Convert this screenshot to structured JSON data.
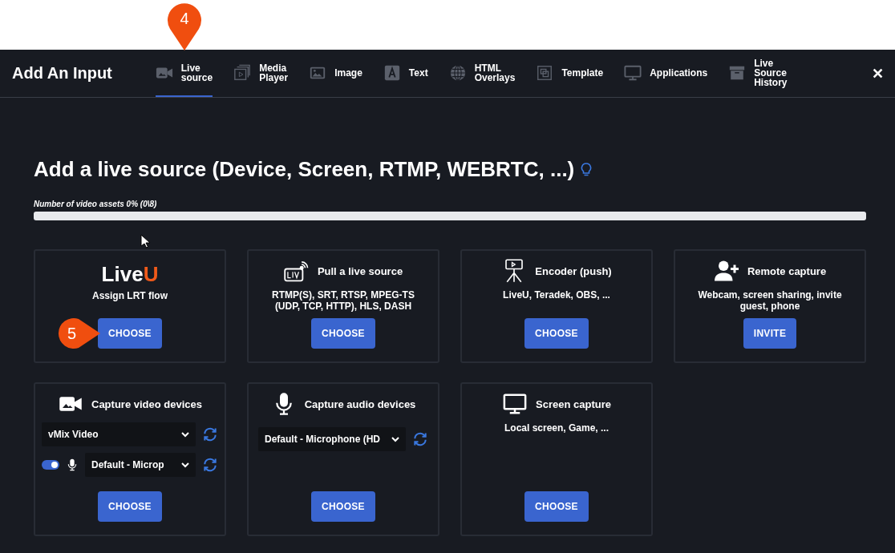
{
  "header": {
    "title": "Add An Input",
    "close": "✕"
  },
  "tabs": [
    {
      "lines": [
        "Live",
        "source"
      ],
      "selected": true
    },
    {
      "lines": [
        "Media",
        "Player"
      ],
      "selected": false
    },
    {
      "lines": [
        "Image"
      ],
      "selected": false
    },
    {
      "lines": [
        "Text"
      ],
      "selected": false
    },
    {
      "lines": [
        "HTML",
        "Overlays"
      ],
      "selected": false
    },
    {
      "lines": [
        "Template"
      ],
      "selected": false
    },
    {
      "lines": [
        "Applications"
      ],
      "selected": false
    },
    {
      "lines": [
        "Live",
        "Source",
        "History"
      ],
      "selected": false
    }
  ],
  "heading": "Add a live source (Device, Screen, RTMP, WEBRTC, ...)",
  "assets": {
    "label": "Number of video assets 0% (0\\8)",
    "level": 0
  },
  "cards": [
    {
      "kind": "logo",
      "logo": {
        "text": "Live",
        "accent": "U"
      },
      "description": "Assign LRT flow",
      "button": "CHOOSE"
    },
    {
      "kind": "basic",
      "title": "Pull a live source",
      "description": "RTMP(S), SRT, RTSP, MPEG-TS (UDP, TCP, HTTP), HLS, DASH",
      "button": "CHOOSE"
    },
    {
      "kind": "basic",
      "title": "Encoder (push)",
      "description": "LiveU, Teradek, OBS, ...",
      "button": "CHOOSE"
    },
    {
      "kind": "basic",
      "title": "Remote capture",
      "description": "Webcam, screen sharing, invite guest, phone",
      "button": "INVITE"
    },
    {
      "kind": "video",
      "title": "Capture video devices",
      "video_device": "vMix Video",
      "audio_on": true,
      "audio_device": "Default - Microp",
      "button": "CHOOSE"
    },
    {
      "kind": "audio",
      "title": "Capture audio devices",
      "audio_device": "Default - Microphone (HD",
      "button": "CHOOSE"
    },
    {
      "kind": "basic",
      "title": "Screen capture",
      "description": "Local screen, Game, ...",
      "button": "CHOOSE"
    }
  ],
  "callouts": [
    {
      "label": "4"
    },
    {
      "label": "5"
    }
  ]
}
